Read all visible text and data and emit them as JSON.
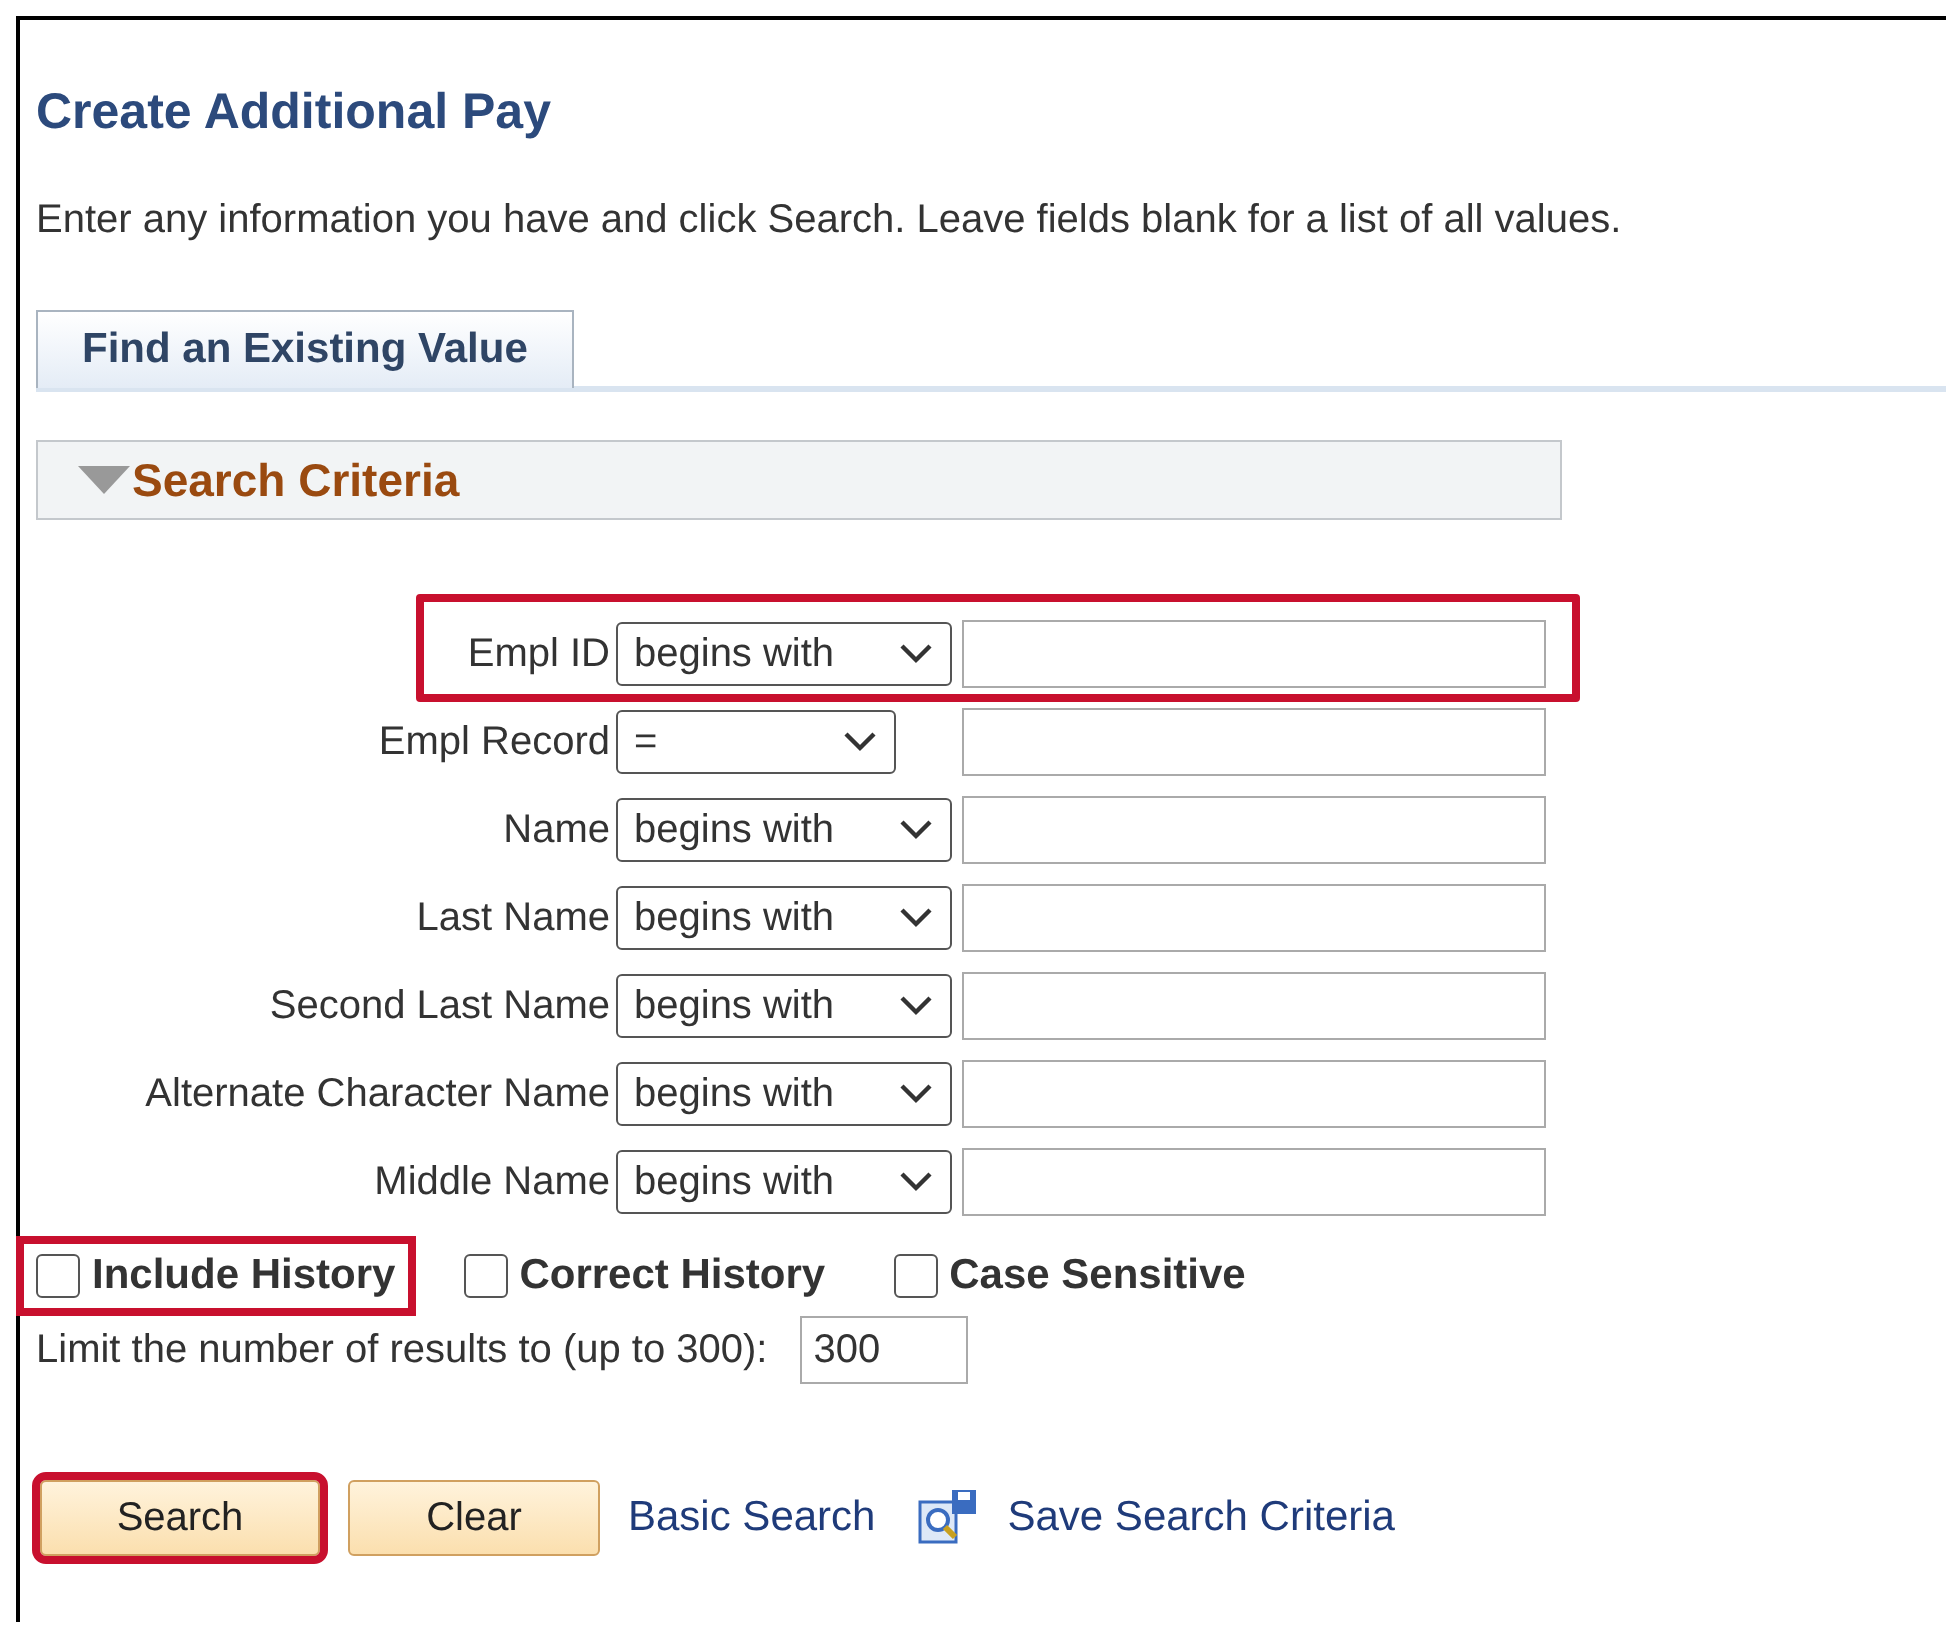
{
  "title": "Create Additional Pay",
  "instructions": "Enter any information you have and click Search. Leave fields blank for a list of all values.",
  "tabs": [
    {
      "label": "Find an Existing Value",
      "selected": true
    }
  ],
  "section": {
    "title": "Search Criteria",
    "expanded": true
  },
  "fields": [
    {
      "label": "Empl ID",
      "operator": "begins with",
      "highlighted": true
    },
    {
      "label": "Empl Record",
      "operator": "=",
      "highlighted": false
    },
    {
      "label": "Name",
      "operator": "begins with",
      "highlighted": false
    },
    {
      "label": "Last Name",
      "operator": "begins with",
      "highlighted": false
    },
    {
      "label": "Second Last Name",
      "operator": "begins with",
      "highlighted": false
    },
    {
      "label": "Alternate Character Name",
      "operator": "begins with",
      "highlighted": false
    },
    {
      "label": "Middle Name",
      "operator": "begins with",
      "highlighted": false
    }
  ],
  "options": [
    {
      "label": "Include History",
      "checked": false,
      "highlighted": true
    },
    {
      "label": "Correct History",
      "checked": false,
      "highlighted": false
    },
    {
      "label": "Case Sensitive",
      "checked": false,
      "highlighted": false
    }
  ],
  "limit": {
    "label": "Limit the number of results to (up to 300):",
    "value": "300"
  },
  "actions": [
    {
      "kind": "button",
      "label": "Search",
      "highlighted": true
    },
    {
      "kind": "button",
      "label": "Clear",
      "highlighted": false
    },
    {
      "kind": "link",
      "label": "Basic Search",
      "highlighted": false
    },
    {
      "kind": "icon-link",
      "label": "Save Search Criteria",
      "highlighted": false
    }
  ]
}
